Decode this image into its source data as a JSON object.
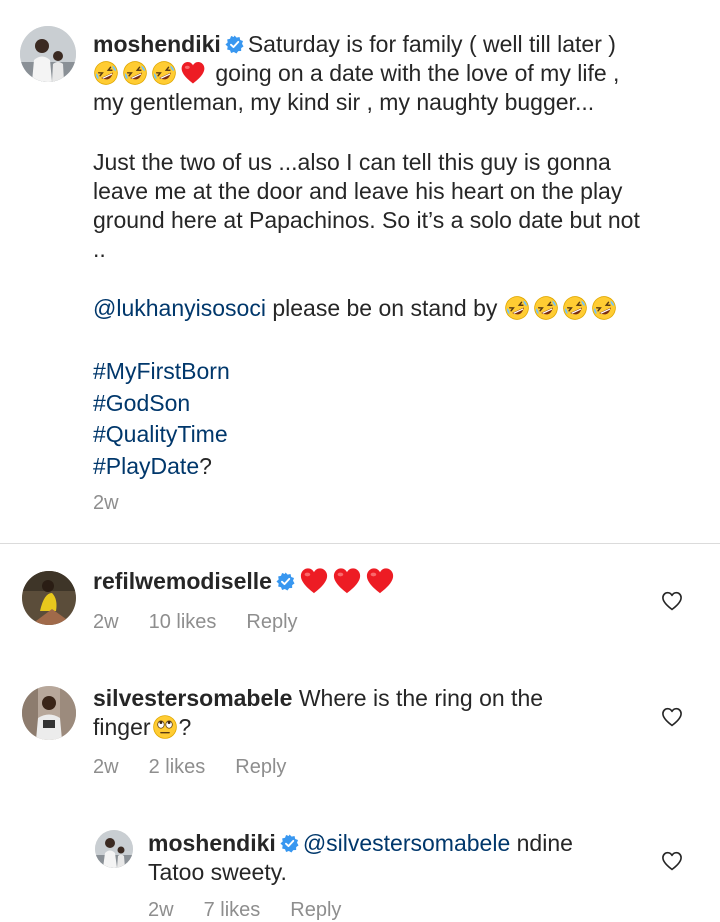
{
  "caption": {
    "username": "moshendiki",
    "line1": "Saturday is for family ( well till later )",
    "line2_text": "going on a date with the love of my life ,",
    "line3": "my gentleman, my kind sir , my naughty bugger...",
    "para2": [
      "Just the two of us ...also I can tell this guy is gonna",
      "leave me at the door and leave his heart on the play",
      "ground here at Papachinos. So it’s a solo date but not",
      ".."
    ],
    "mention": "@lukhanyisosoci",
    "mention_text": "please be on stand by",
    "hashtags": [
      "#MyFirstBorn",
      "#GodSon",
      "#QualityTime",
      "#PlayDate"
    ],
    "hashtag_suffix": "?",
    "time": "2w"
  },
  "comments": [
    {
      "username": "refilwemodiselle",
      "text": "",
      "time": "2w",
      "likes": "10 likes",
      "reply": "Reply"
    },
    {
      "username": "silvestersomabele",
      "text_line1": "Where is the ring on the",
      "text_line2a": "finger",
      "text_line2b": "?",
      "time": "2w",
      "likes": "2 likes",
      "reply": "Reply"
    },
    {
      "username": "moshendiki",
      "mention": "@silvestersomabele",
      "text_line1": "ndine",
      "text_line2": "Tatoo sweety.",
      "time": "2w",
      "likes": "7 likes",
      "reply": "Reply"
    }
  ],
  "icons": {
    "verified": "verified-badge-icon",
    "heart_emoji": "red-heart-emoji",
    "laugh_emoji": "rolling-laughing-emoji",
    "eyeroll_emoji": "eye-roll-emoji",
    "like": "heart-outline-icon"
  },
  "colors": {
    "text": "#262626",
    "secondary": "#8e8e8e",
    "link": "#00376b",
    "verified": "#3897f0",
    "heart": "#ed1c24"
  }
}
